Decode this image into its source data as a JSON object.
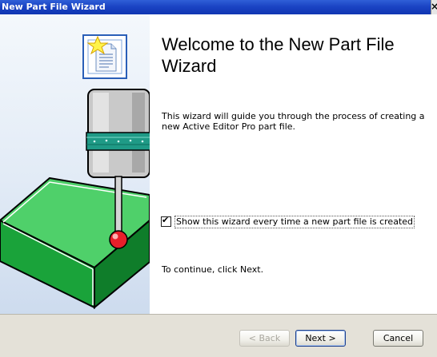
{
  "window": {
    "title": "New Part File Wizard",
    "close_glyph": "×"
  },
  "graphic": {
    "icons": [
      "new-document-icon",
      "cmm-probe-illustration"
    ]
  },
  "content": {
    "heading": "Welcome to the New Part File Wizard",
    "intro": "This wizard will guide you through the process of creating a new Active Editor Pro part file.",
    "checkbox": {
      "label": "Show this wizard every time a new part file is created",
      "checked": true,
      "mark": "✔"
    },
    "continue_text": "To continue, click Next."
  },
  "buttons": {
    "back": "< Back",
    "next": "Next >",
    "cancel": "Cancel"
  },
  "colors": {
    "title_bar": "#1b44c4",
    "button_bar": "#e4e1d8",
    "block_green": "#1aa33a",
    "probe_ball": "#e8202a"
  }
}
